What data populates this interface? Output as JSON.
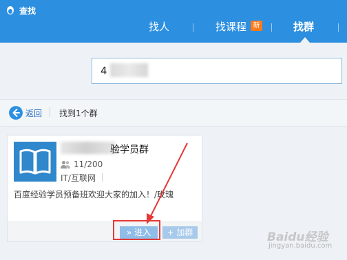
{
  "window": {
    "title": "查找"
  },
  "nav": {
    "tabs": [
      {
        "label": "找人",
        "active": false
      },
      {
        "label": "找课程",
        "badge": "新",
        "active": false
      },
      {
        "label": "找群",
        "active": true
      }
    ]
  },
  "search": {
    "value": "4"
  },
  "results_bar": {
    "back_label": "返回",
    "count_text": "找到1个群"
  },
  "result": {
    "name_visible": "验学员群",
    "member_count": "11/200",
    "category": "IT/互联网",
    "description": "百度经验学员预备班欢迎大家的加入！/玫瑰",
    "enter_label": "» 进入",
    "join_label": "+ 加群"
  },
  "watermark": {
    "line1": "Baidu经验",
    "line2": "jingyan.baidu.com"
  },
  "colors": {
    "titlebar": "#2c8fe0",
    "highlight": "#e53935",
    "badge": "#ff7a1a"
  }
}
